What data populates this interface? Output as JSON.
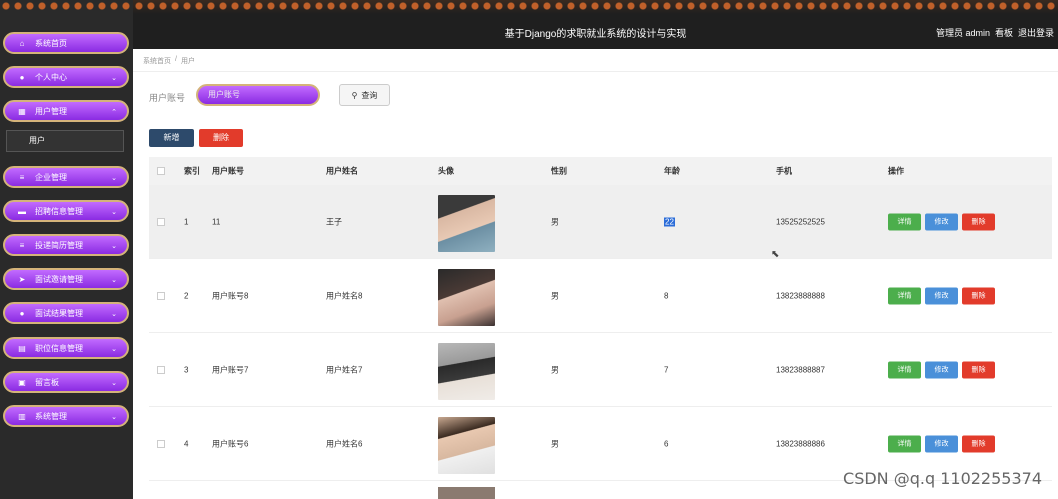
{
  "header": {
    "title": "基于Django的求职就业系统的设计与实现",
    "right_links": [
      "管理员 admin",
      "看板",
      "退出登录"
    ]
  },
  "sidebar": {
    "items": [
      {
        "label": "系统首页",
        "icon": "home-icon",
        "glyph": "⌂"
      },
      {
        "label": "个人中心",
        "icon": "user-icon",
        "glyph": "●"
      },
      {
        "label": "用户管理",
        "icon": "grid-icon",
        "glyph": "▦"
      },
      {
        "label": "企业管理",
        "icon": "list-icon",
        "glyph": "≡"
      },
      {
        "label": "招聘信息管理",
        "icon": "monitor-icon",
        "glyph": "▬"
      },
      {
        "label": "投递简历管理",
        "icon": "list-icon",
        "glyph": "≡"
      },
      {
        "label": "面试邀请管理",
        "icon": "send-icon",
        "glyph": "➤"
      },
      {
        "label": "面试结果管理",
        "icon": "user-icon",
        "glyph": "●"
      },
      {
        "label": "职位信息管理",
        "icon": "doc-icon",
        "glyph": "▤"
      },
      {
        "label": "留言板",
        "icon": "clipboard-icon",
        "glyph": "▣"
      },
      {
        "label": "系统管理",
        "icon": "chart-icon",
        "glyph": "▥"
      }
    ],
    "submenu_label": "用户"
  },
  "breadcrumb": [
    "系统首页",
    "/",
    "用户"
  ],
  "search": {
    "label": "用户账号",
    "placeholder": "用户账号",
    "button_label": "查询"
  },
  "actions": {
    "add": "新增",
    "delete": "删除"
  },
  "table": {
    "columns": [
      "索引",
      "用户账号",
      "用户姓名",
      "头像",
      "性别",
      "年龄",
      "手机",
      "操作"
    ],
    "rows": [
      {
        "index": "1",
        "account": "11",
        "name": "王子",
        "gender": "男",
        "age": "22",
        "phone": "13525252525"
      },
      {
        "index": "2",
        "account": "用户账号8",
        "name": "用户姓名8",
        "gender": "男",
        "age": "8",
        "phone": "13823888888"
      },
      {
        "index": "3",
        "account": "用户账号7",
        "name": "用户姓名7",
        "gender": "男",
        "age": "7",
        "phone": "13823888887"
      },
      {
        "index": "4",
        "account": "用户账号6",
        "name": "用户姓名6",
        "gender": "男",
        "age": "6",
        "phone": "13823888886"
      }
    ],
    "ops": {
      "detail": "详情",
      "edit": "修改",
      "delete": "删除"
    }
  },
  "watermark": "CSDN @q.q 1102255374",
  "colors": {
    "menu_purple": "#a64dff",
    "gold_border": "#d4b37a",
    "danger": "#e23b2b",
    "success": "#4cae4c",
    "primary": "#4a90d9",
    "navy": "#2d4a6b"
  }
}
